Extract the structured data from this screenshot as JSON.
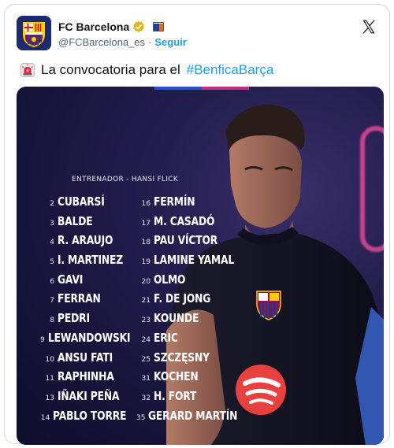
{
  "account": {
    "display_name": "FC Barcelona",
    "handle": "@FCBarcelona_es",
    "separator": "·",
    "follow_label": "Seguir"
  },
  "tweet": {
    "text": "La convocatoria para el",
    "hashtag": "#BenficaBarça"
  },
  "media": {
    "coach_line": "ENTRENADOR - HANSI FLICK",
    "squad_left": [
      {
        "num": "2",
        "name": "CUBARSÍ"
      },
      {
        "num": "3",
        "name": "BALDE"
      },
      {
        "num": "4",
        "name": "R. ARAUJO"
      },
      {
        "num": "5",
        "name": "I. MARTINEZ"
      },
      {
        "num": "6",
        "name": "GAVI"
      },
      {
        "num": "7",
        "name": "FERRAN"
      },
      {
        "num": "8",
        "name": "PEDRI"
      },
      {
        "num": "9",
        "name": "LEWANDOWSKI"
      },
      {
        "num": "10",
        "name": "ANSU FATI"
      },
      {
        "num": "11",
        "name": "RAPHINHA"
      },
      {
        "num": "13",
        "name": "IÑAKI PEÑA"
      },
      {
        "num": "14",
        "name": "PABLO TORRE"
      }
    ],
    "squad_right": [
      {
        "num": "16",
        "name": "FERMÍN"
      },
      {
        "num": "17",
        "name": "M. CASADÓ"
      },
      {
        "num": "18",
        "name": "PAU VÍCTOR"
      },
      {
        "num": "19",
        "name": "LAMINE YAMAL"
      },
      {
        "num": "20",
        "name": "OLMO"
      },
      {
        "num": "21",
        "name": "F. DE JONG"
      },
      {
        "num": "23",
        "name": "KOUNDE"
      },
      {
        "num": "24",
        "name": "ERIC"
      },
      {
        "num": "25",
        "name": "SZCZĘSNY"
      },
      {
        "num": "31",
        "name": "KOCHEN"
      },
      {
        "num": "32",
        "name": "H. FORT"
      },
      {
        "num": "35",
        "name": "GERARD MARTÍN"
      }
    ]
  },
  "colors": {
    "link": "#1d9bf0",
    "barca_blue": "#004d98",
    "barca_garnet": "#a50044",
    "spotify_red": "#e83f3f"
  },
  "icons": [
    "fcb-crest-icon",
    "verified-badge-icon",
    "catalan-flag-icon",
    "x-logo-icon",
    "siren-icon",
    "spotify-icon"
  ]
}
